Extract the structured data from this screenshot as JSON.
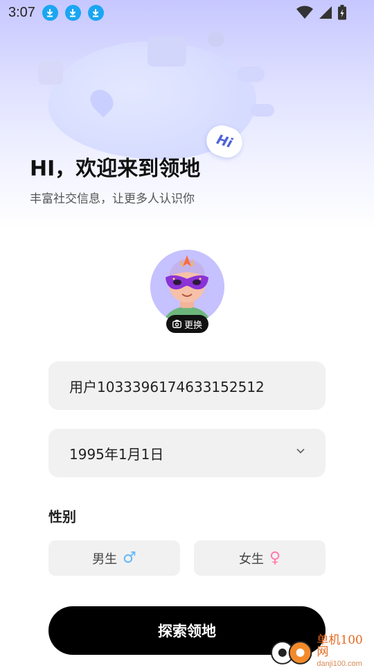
{
  "status_bar": {
    "time": "3:07",
    "download_icons": [
      "download-icon",
      "download-icon",
      "download-icon"
    ],
    "right_icons": [
      "wifi-icon",
      "signal-icon",
      "battery-icon"
    ]
  },
  "hero": {
    "title": "HI，欢迎来到领地",
    "subtitle": "丰富社交信息，让更多人认识你",
    "bubble_text": "Hi"
  },
  "avatar": {
    "change_label": "更换"
  },
  "form": {
    "username_value": "用户1033396174633152512",
    "birthday_value": "1995年1月1日",
    "gender_label": "性别",
    "gender_options": [
      {
        "label": "男生",
        "symbol": "♂"
      },
      {
        "label": "女生",
        "symbol": "♀"
      }
    ],
    "submit_label": "探索领地"
  },
  "watermark": {
    "name": "单机100网",
    "domain": "danji100.com"
  },
  "colors": {
    "accent_black": "#000000",
    "download_blue": "#1aa6f2",
    "male_blue": "#5eb6ff",
    "female_pink": "#ff79ad",
    "hero_lavender": "#c6c7ff"
  }
}
